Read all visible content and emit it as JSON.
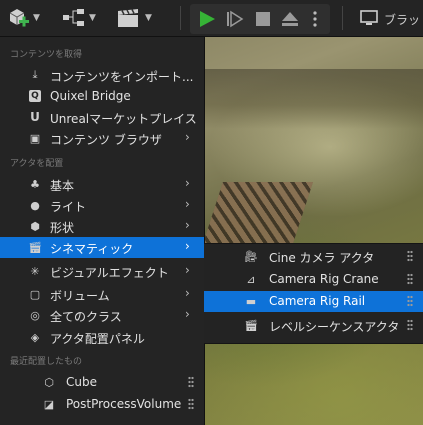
{
  "toolbar": {
    "bp_label": "ブラット"
  },
  "menu": {
    "sections": {
      "get_content": "コンテンツを取得",
      "place_actors": "アクタを配置",
      "recent": "最近配置したもの"
    },
    "items": [
      {
        "label": "コンテンツをインポート...",
        "icon": "import-icon"
      },
      {
        "label": "Quixel Bridge",
        "icon": "quixel-icon"
      },
      {
        "label": "Unrealマーケットプレイス",
        "icon": "marketplace-icon"
      },
      {
        "label": "コンテンツ ブラウザ",
        "icon": "folder-icon"
      },
      {
        "label": "基本",
        "icon": "basic-icon"
      },
      {
        "label": "ライト",
        "icon": "light-icon"
      },
      {
        "label": "形状",
        "icon": "shape-icon"
      },
      {
        "label": "シネマティック",
        "icon": "clapper-icon"
      },
      {
        "label": "ビジュアルエフェクト",
        "icon": "vfx-icon"
      },
      {
        "label": "ボリューム",
        "icon": "volume-icon"
      },
      {
        "label": "全てのクラス",
        "icon": "classes-icon"
      },
      {
        "label": "アクタ配置パネル",
        "icon": "panel-icon"
      }
    ],
    "recent": [
      {
        "label": "Cube",
        "icon": "cube-icon"
      },
      {
        "label": "PostProcessVolume",
        "icon": "postprocess-icon"
      }
    ]
  },
  "submenu": {
    "items": [
      {
        "label": "Cine カメラ アクタ",
        "icon": "cine-camera-icon"
      },
      {
        "label": "Camera Rig Crane",
        "icon": "crane-icon"
      },
      {
        "label": "Camera Rig Rail",
        "icon": "rail-icon"
      },
      {
        "label": "レベルシーケンスアクタ",
        "icon": "sequence-icon"
      }
    ],
    "active_index": 2
  },
  "colors": {
    "accent": "#0e72d8",
    "play": "#36b336",
    "add": "#3fb34f"
  }
}
